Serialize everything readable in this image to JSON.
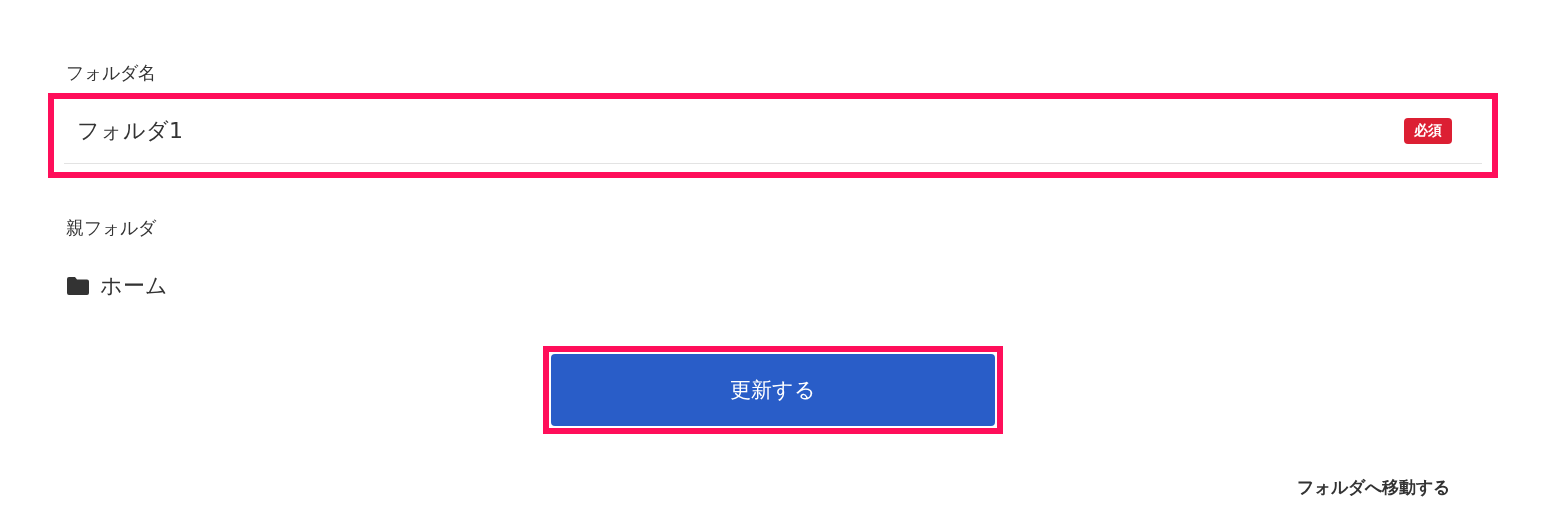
{
  "folder_name": {
    "label": "フォルダ名",
    "value": "フォルダ1",
    "badge": "必須"
  },
  "parent_folder": {
    "label": "親フォルダ",
    "value": "ホーム"
  },
  "submit_button": "更新する",
  "link": "フォルダへ移動する"
}
